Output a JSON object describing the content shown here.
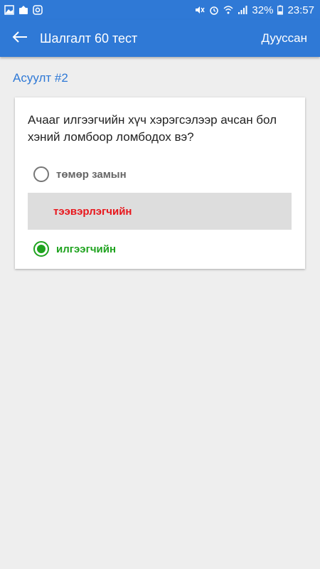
{
  "status_bar": {
    "battery": "32%",
    "time": "23:57",
    "left_icons": [
      "gallery-icon",
      "upload-icon",
      "instagram-icon"
    ],
    "right_icons": [
      "mute-icon",
      "alarm-icon",
      "wifi-icon",
      "signal-icon",
      "battery-icon"
    ]
  },
  "app_bar": {
    "title": "Шалгалт 60 тест",
    "finish_label": "Дуусcан",
    "back_icon": "arrow-left-icon",
    "color": "#2f79d6"
  },
  "question": {
    "label": "Асуулт #2",
    "text": "Ачааг илгээгчийн хүч хэрэгсэлээр ачсан бол хэний ломбоор ломбодох вэ?",
    "options": [
      {
        "label": "төмөр замын",
        "state": "unselected"
      },
      {
        "label": "тээвэрлэгчийн",
        "state": "correct-answer",
        "color": "#e8161c"
      },
      {
        "label": "илгээгчийн",
        "state": "selected",
        "color": "#1fa31f"
      }
    ]
  }
}
